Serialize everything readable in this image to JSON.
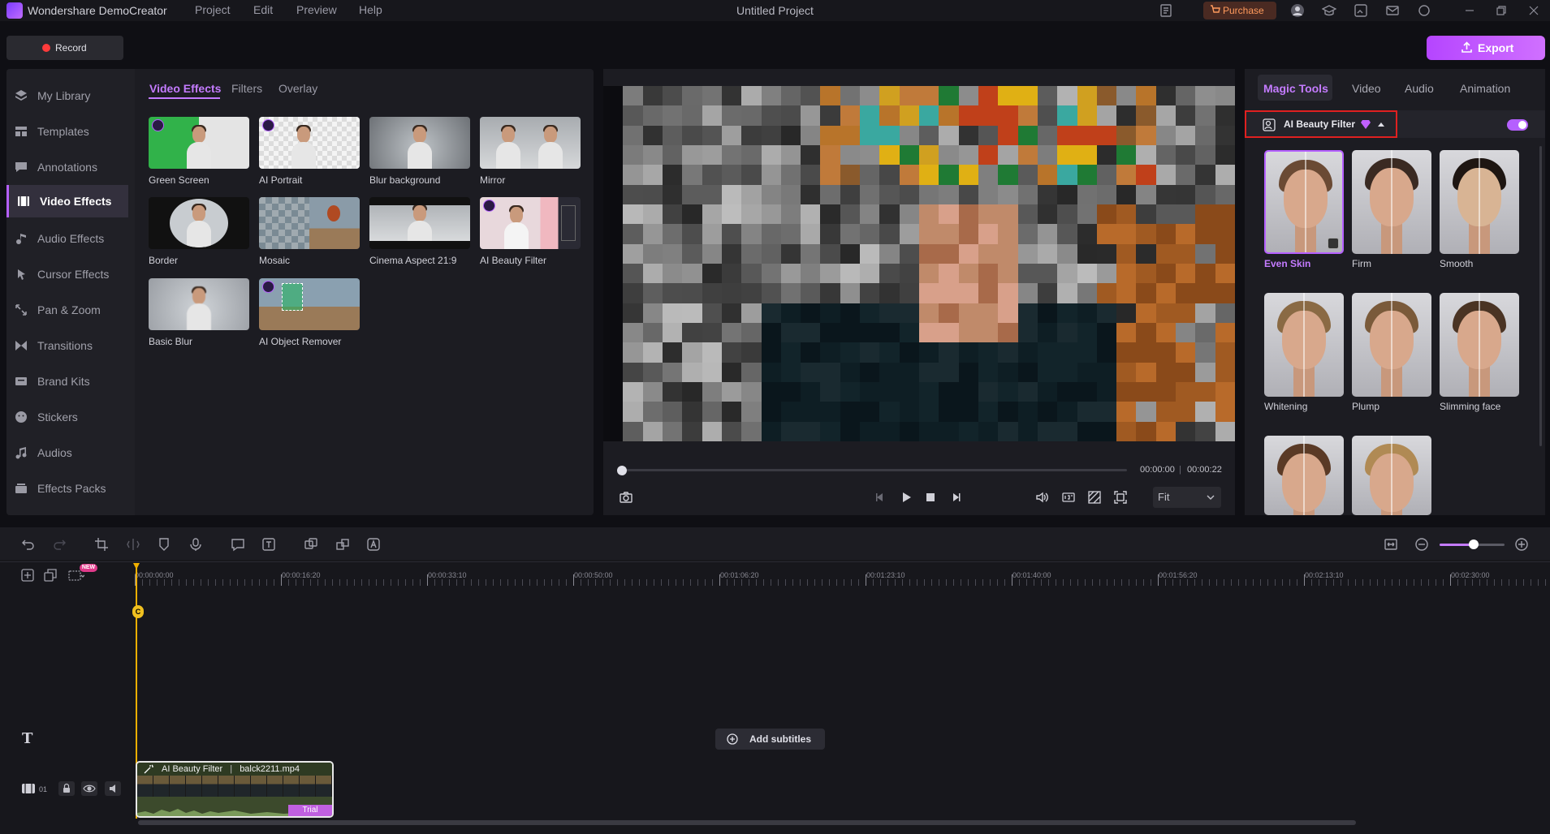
{
  "titlebar": {
    "app_name": "Wondershare DemoCreator",
    "menu": [
      "Project",
      "Edit",
      "Preview",
      "Help"
    ],
    "project_title": "Untitled Project",
    "purchase_label": "Purchase"
  },
  "actions": {
    "record_label": "Record",
    "export_label": "Export"
  },
  "sidebar": {
    "items": [
      {
        "label": "My Library",
        "icon": "layers-icon"
      },
      {
        "label": "Templates",
        "icon": "template-icon"
      },
      {
        "label": "Annotations",
        "icon": "annotation-icon"
      },
      {
        "label": "Video Effects",
        "icon": "video-effects-icon",
        "active": true
      },
      {
        "label": "Audio Effects",
        "icon": "audio-effects-icon"
      },
      {
        "label": "Cursor Effects",
        "icon": "cursor-effects-icon"
      },
      {
        "label": "Pan & Zoom",
        "icon": "pan-zoom-icon"
      },
      {
        "label": "Transitions",
        "icon": "transitions-icon"
      },
      {
        "label": "Brand Kits",
        "icon": "brand-kits-icon"
      },
      {
        "label": "Stickers",
        "icon": "stickers-icon"
      },
      {
        "label": "Audios",
        "icon": "music-note-icon"
      },
      {
        "label": "Effects Packs",
        "icon": "effects-packs-icon"
      }
    ]
  },
  "effects_tabs": [
    "Video Effects",
    "Filters",
    "Overlay"
  ],
  "effects": [
    {
      "label": "Green Screen",
      "premium": true
    },
    {
      "label": "AI Portrait",
      "premium": true
    },
    {
      "label": "Blur background",
      "premium": false
    },
    {
      "label": "Mirror",
      "premium": false
    },
    {
      "label": "Border",
      "premium": false
    },
    {
      "label": "Mosaic",
      "premium": false
    },
    {
      "label": "Cinema Aspect 21:9",
      "premium": false
    },
    {
      "label": "AI Beauty Filter",
      "premium": true
    },
    {
      "label": "Basic Blur",
      "premium": false
    },
    {
      "label": "AI Object Remover",
      "premium": true
    }
  ],
  "player": {
    "current_time": "00:00:00",
    "separator": "|",
    "total_time": "00:00:22",
    "fit_label": "Fit",
    "progress": 0
  },
  "right_tabs": [
    "Magic Tools",
    "Video",
    "Audio",
    "Animation"
  ],
  "beauty": {
    "label": "AI Beauty Filter",
    "enabled": true,
    "presets": [
      "Even Skin",
      "Firm",
      "Smooth",
      "Whitening",
      "Plump",
      "Slimming face",
      "",
      ""
    ],
    "selected": "Even Skin"
  },
  "timeline": {
    "ruler_labels": [
      "00:00:00:00",
      "00:00:16:20",
      "00:00:33:10",
      "00:00:50:00",
      "00:01:06:20",
      "00:01:23:10",
      "00:01:40:00",
      "00:01:56:20",
      "00:02:13:10",
      "00:02:30:00"
    ],
    "new_badge": "NEW",
    "playhead_marker": "C",
    "add_subtitles_label": "Add subtitles",
    "track_number": "01",
    "clip_effect": "AI Beauty Filter",
    "clip_file": "balck2211.mp4",
    "clip_trial": "Trial",
    "zoom_level": 0.55
  },
  "colors": {
    "accent": "#b560ff",
    "record": "#ff3b3b",
    "playhead": "#f0b000",
    "highlight_box": "#e02020"
  }
}
